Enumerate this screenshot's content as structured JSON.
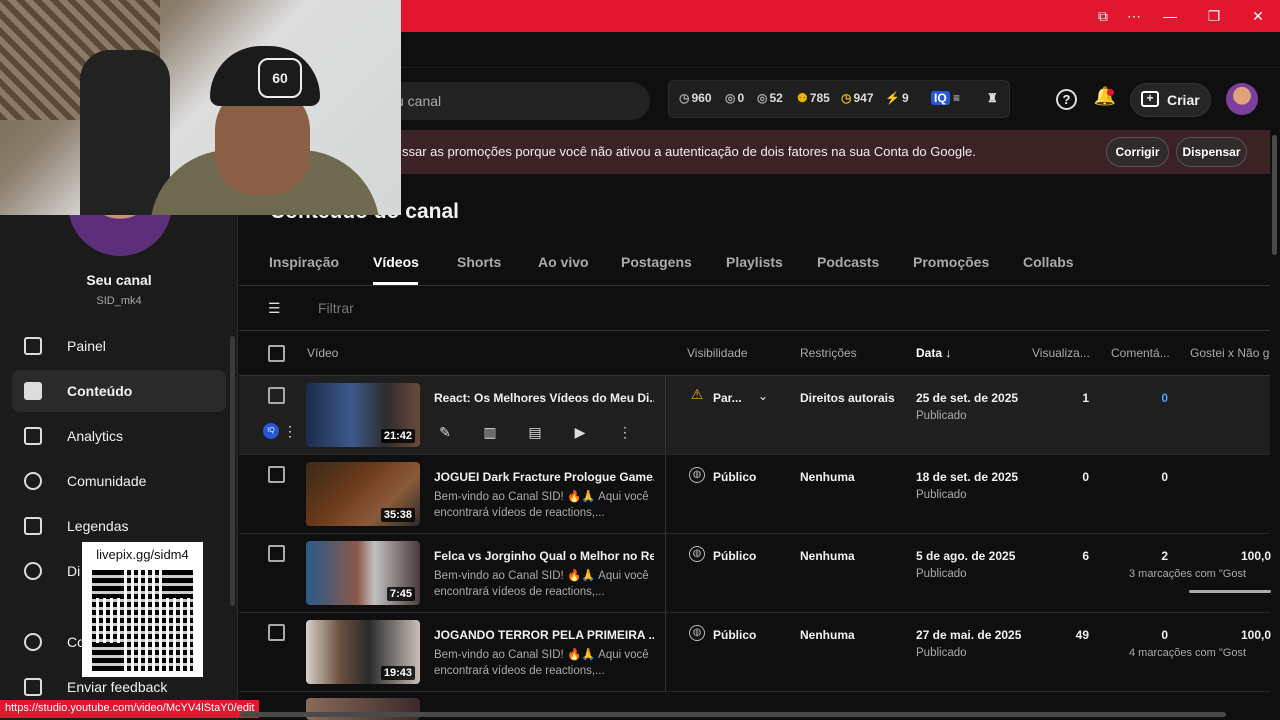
{
  "window": {
    "controls": [
      "⧉",
      "⋯",
      "—",
      "❐",
      "✕"
    ]
  },
  "header": {
    "search_text": "u canal",
    "stats": [
      {
        "icon": "clock-icon",
        "value": "960"
      },
      {
        "icon": "eye-off-icon",
        "value": "0"
      },
      {
        "icon": "eye-icon",
        "value": "52"
      },
      {
        "icon": "people-icon",
        "value": "785"
      },
      {
        "icon": "clock-gold-icon",
        "value": "947"
      },
      {
        "icon": "bolt-icon",
        "value": "9"
      }
    ],
    "create_label": "Criar"
  },
  "notice": {
    "text": "ssar as promoções porque você não ativou a autenticação de dois fatores na sua Conta do Google.",
    "fix_label": "Corrigir",
    "dismiss_label": "Dispensar"
  },
  "sidebar": {
    "channel_name": "Seu canal",
    "channel_handle": "SID_mk4",
    "items": [
      {
        "label": "Painel",
        "icon": "dashboard-icon"
      },
      {
        "label": "Conteúdo",
        "icon": "content-icon",
        "active": true
      },
      {
        "label": "Analytics",
        "icon": "analytics-icon"
      },
      {
        "label": "Comunidade",
        "icon": "community-icon"
      },
      {
        "label": "Legendas",
        "icon": "subtitles-icon"
      },
      {
        "label": "Di",
        "icon": "copyright-icon"
      },
      {
        "label": "Co",
        "icon": "settings-icon"
      },
      {
        "label": "Enviar feedback",
        "icon": "feedback-icon"
      }
    ]
  },
  "page": {
    "title": "Conteúdo do canal",
    "tabs": [
      "Inspiração",
      "Vídeos",
      "Shorts",
      "Ao vivo",
      "Postagens",
      "Playlists",
      "Podcasts",
      "Promoções",
      "Collabs"
    ],
    "filter_placeholder": "Filtrar"
  },
  "table": {
    "headers": {
      "video": "Vídeo",
      "visibility": "Visibilidade",
      "restrictions": "Restrições",
      "date": "Data",
      "views": "Visualiza...",
      "comments": "Comentá...",
      "likes": "Gostei x Não go"
    },
    "rows": [
      {
        "title": "React: Os Melhores Vídeos do Meu Di...",
        "description": "",
        "duration": "21:42",
        "visibility": "Par...",
        "restriction": "Direitos autorais",
        "date": "25 de set. de 2025",
        "status": "Publicado",
        "views": "1",
        "comments": "0",
        "likes": "",
        "likes_sub": ""
      },
      {
        "title": "JOGUEI Dark Fracture Prologue Game...",
        "description": "Bem-vindo ao Canal SID! 🔥🙏 Aqui você encontrará vídeos de reactions,...",
        "duration": "35:38",
        "visibility": "Público",
        "restriction": "Nenhuma",
        "date": "18 de set. de 2025",
        "status": "Publicado",
        "views": "0",
        "comments": "0",
        "likes": "",
        "likes_sub": ""
      },
      {
        "title": "Felca vs Jorginho Qual o Melhor no Re...",
        "description": "Bem-vindo ao Canal SID! 🔥🙏 Aqui você encontrará vídeos de reactions,...",
        "duration": "7:45",
        "visibility": "Público",
        "restriction": "Nenhuma",
        "date": "5 de ago. de 2025",
        "status": "Publicado",
        "views": "6",
        "comments": "2",
        "likes": "100,0",
        "likes_sub": "3 marcações com \"Gost"
      },
      {
        "title": "JOGANDO TERROR PELA PRIMEIRA ...",
        "description": "Bem-vindo ao Canal SID! 🔥🙏 Aqui você encontrará vídeos de reactions,...",
        "duration": "19:43",
        "visibility": "Público",
        "restriction": "Nenhuma",
        "date": "27 de mai. de 2025",
        "status": "Publicado",
        "views": "49",
        "comments": "0",
        "likes": "100,0",
        "likes_sub": "4 marcações com \"Gost"
      }
    ]
  },
  "overlay": {
    "qr_label": "livepix.gg/sidm4",
    "webcam_cap_logo": "60"
  },
  "status_url": "https://studio.youtube.com/video/McYV4lStaY0/edit",
  "colors": {
    "accent": "#e2162e",
    "link": "#3ea6ff",
    "background": "#0f0f0f"
  }
}
